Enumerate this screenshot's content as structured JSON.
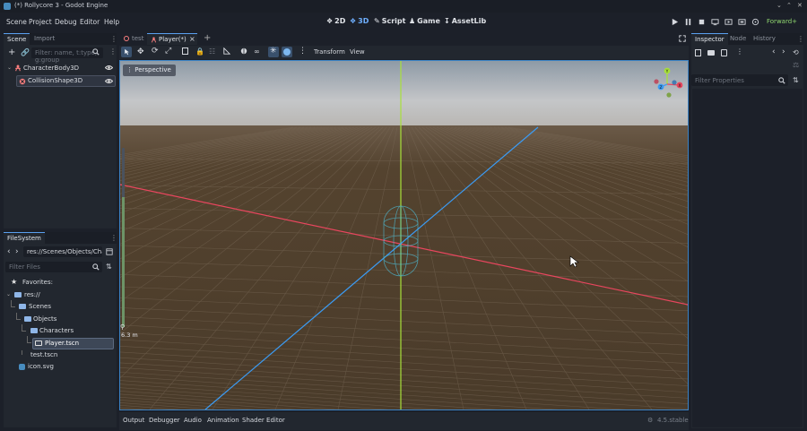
{
  "window": {
    "title": "(*) Rollycore 3 - Godot Engine",
    "controls": [
      "minimize-icon",
      "restore-icon",
      "close-icon"
    ]
  },
  "menu": {
    "items": [
      "Scene",
      "Project",
      "Debug",
      "Editor",
      "Help"
    ],
    "modes": [
      {
        "label": "2D",
        "icon": "2d-icon",
        "active": false
      },
      {
        "label": "3D",
        "icon": "3d-icon",
        "active": true
      },
      {
        "label": "Script",
        "icon": "script-icon",
        "active": false
      },
      {
        "label": "Game",
        "icon": "game-icon",
        "active": false
      },
      {
        "label": "AssetLib",
        "icon": "assetlib-icon",
        "active": false
      }
    ],
    "renderer": "Forward+"
  },
  "scene_dock": {
    "tabs": [
      "Scene",
      "Import"
    ],
    "active_tab": "Scene",
    "filter_placeholder": "Filter: name, t:type, g:group",
    "nodes": [
      {
        "name": "CharacterBody3D",
        "icon": "character-body-icon",
        "depth": 0
      },
      {
        "name": "CollisionShape3D",
        "icon": "collision-shape-icon",
        "depth": 1
      }
    ]
  },
  "filesystem_dock": {
    "tab": "FileSystem",
    "path": "res://Scenes/Objects/Char",
    "filter_placeholder": "Filter Files",
    "favorites": "Favorites:",
    "items": [
      {
        "name": "res://",
        "type": "folder",
        "depth": 0
      },
      {
        "name": "Scenes",
        "type": "folder",
        "depth": 1
      },
      {
        "name": "Objects",
        "type": "folder",
        "depth": 2
      },
      {
        "name": "Characters",
        "type": "folder",
        "depth": 3
      },
      {
        "name": "Player.tscn",
        "type": "scene",
        "depth": 4,
        "selected": true
      },
      {
        "name": "test.tscn",
        "type": "scene",
        "depth": 2
      },
      {
        "name": "icon.svg",
        "type": "image",
        "depth": 1
      }
    ]
  },
  "editor_tabs": [
    {
      "label": "test",
      "active": false
    },
    {
      "label": "Player(*)",
      "active": true
    }
  ],
  "toolbar": {
    "transform_menu": "Transform",
    "view_menu": "View"
  },
  "viewport": {
    "perspective_label": "Perspective",
    "zoom_readout": "6.3 m",
    "gizmo_axes": [
      "X",
      "Y",
      "Z"
    ],
    "colors": {
      "x_axis": "#e8465e",
      "y_axis": "#a8e03a",
      "z_axis": "#3b9cf5",
      "sky": "#c4c6c8",
      "ground": "#4a3b2a"
    }
  },
  "bottom_panel": {
    "tabs": [
      "Output",
      "Debugger",
      "Audio",
      "Animation",
      "Shader Editor"
    ],
    "version": "4.5.stable"
  },
  "inspector": {
    "tabs": [
      "Inspector",
      "Node",
      "History"
    ],
    "active_tab": "Inspector",
    "filter_placeholder": "Filter Properties"
  }
}
